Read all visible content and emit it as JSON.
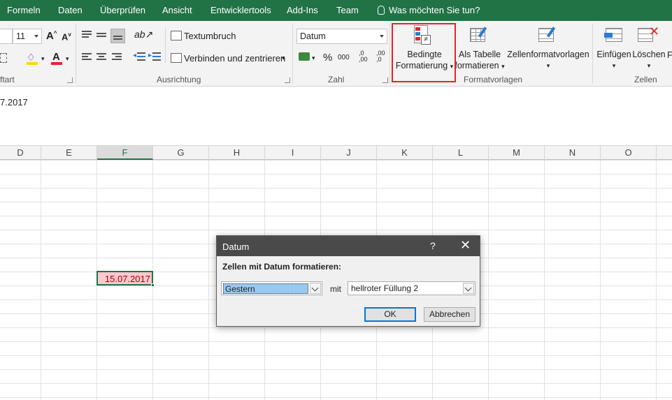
{
  "tabs": [
    "Formeln",
    "Daten",
    "Überprüfen",
    "Ansicht",
    "Entwicklertools",
    "Add-Ins",
    "Team"
  ],
  "tell_me": "Was möchten Sie tun?",
  "ribbon": {
    "font_size": "11",
    "font_group_label": "ftart",
    "alignment": {
      "wrap_text": "Textumbruch",
      "merge_center": "Verbinden und zentrieren",
      "label": "Ausrichtung"
    },
    "number": {
      "format": "Datum",
      "label": "Zahl",
      "percent": "%",
      "thousands": "000",
      "inc_decimal": ",0\n,00",
      "dec_decimal": ",00\n,0"
    },
    "styles": {
      "conditional_line1": "Bedingte",
      "conditional_line2": "Formatierung",
      "as_table_line1": "Als Tabelle",
      "as_table_line2": "formatieren",
      "cell_styles": "Zellenformatvorlagen",
      "label": "Formatvorlagen"
    },
    "cells": {
      "insert": "Einfügen",
      "delete": "Löschen",
      "format_partial": "F",
      "label": "Zellen"
    },
    "accent_color": "#217346",
    "highlight_color": "#e3242b"
  },
  "formula_bar": {
    "value": "7.2017"
  },
  "columns": [
    "D",
    "E",
    "F",
    "G",
    "H",
    "I",
    "J",
    "K",
    "L",
    "M",
    "N",
    "O"
  ],
  "selected_column": "F",
  "active_cell": {
    "value": "15.07.2017",
    "fill": "#ffc7ce",
    "font_color": "#9c0006"
  },
  "dialog": {
    "title": "Datum",
    "help": "?",
    "close": "✕",
    "heading": "Zellen mit Datum formatieren:",
    "condition": "Gestern",
    "with_label": "mit",
    "format": "hellroter Füllung 2",
    "ok": "OK",
    "cancel": "Abbrechen"
  }
}
